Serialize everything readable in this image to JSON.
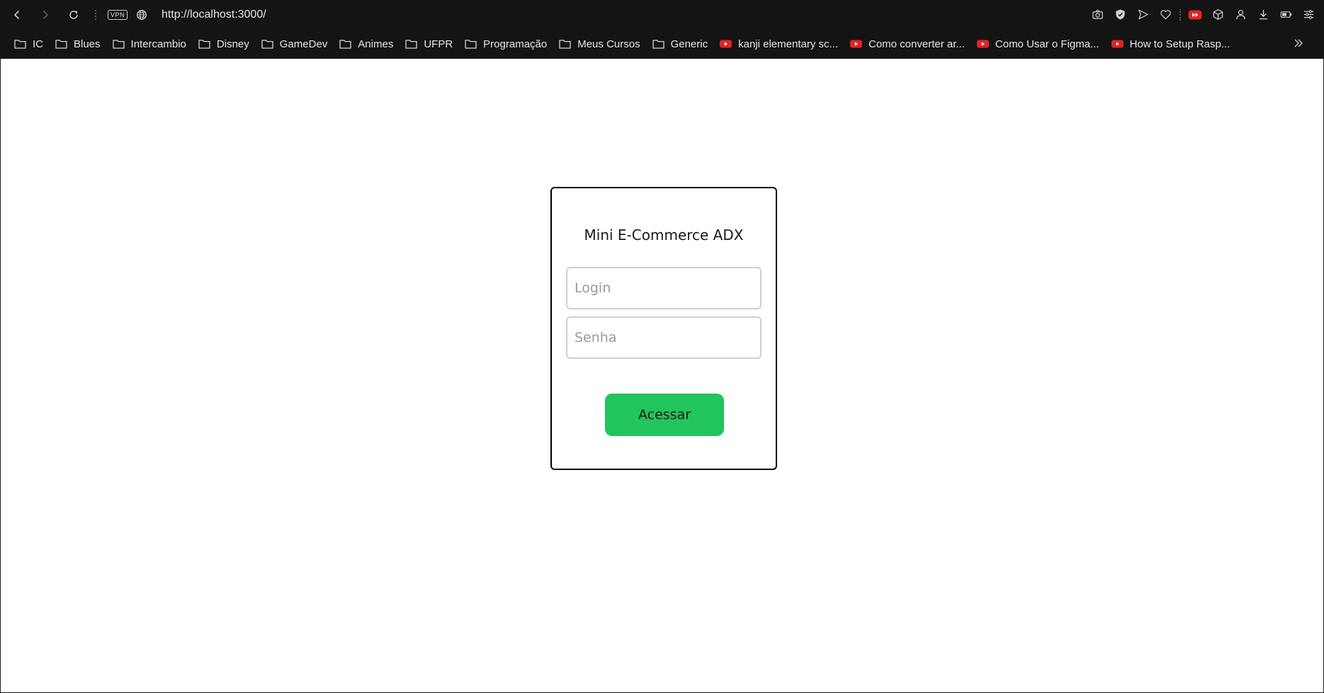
{
  "browser": {
    "vpn_label": "VPN",
    "url": "http://localhost:3000/",
    "nav": {
      "back_icon": "chevron-left-icon",
      "forward_icon": "chevron-right-icon",
      "reload_icon": "reload-icon"
    },
    "toolbar_icons": [
      "camera-icon",
      "shield-icon",
      "send-icon",
      "heart-icon",
      "youtube-icon",
      "cube-icon",
      "user-icon",
      "download-icon",
      "battery-icon",
      "menu-icon"
    ]
  },
  "bookmarks": [
    {
      "label": "IC",
      "icon": "folder-icon"
    },
    {
      "label": "Blues",
      "icon": "folder-icon"
    },
    {
      "label": "Intercambio",
      "icon": "folder-icon"
    },
    {
      "label": "Disney",
      "icon": "folder-icon"
    },
    {
      "label": "GameDev",
      "icon": "folder-icon"
    },
    {
      "label": "Animes",
      "icon": "folder-icon"
    },
    {
      "label": "UFPR",
      "icon": "folder-icon"
    },
    {
      "label": "Programação",
      "icon": "folder-icon"
    },
    {
      "label": "Meus Cursos",
      "icon": "folder-icon"
    },
    {
      "label": "Generic",
      "icon": "folder-icon"
    },
    {
      "label": "kanji elementary sc...",
      "icon": "youtube-icon"
    },
    {
      "label": "Como converter ar...",
      "icon": "youtube-icon"
    },
    {
      "label": "Como Usar o Figma...",
      "icon": "youtube-icon"
    },
    {
      "label": "How to Setup Rasp...",
      "icon": "youtube-icon"
    }
  ],
  "login": {
    "title": "Mini E-Commerce ADX",
    "login_placeholder": "Login",
    "login_value": "",
    "senha_placeholder": "Senha",
    "senha_value": "",
    "submit_label": "Acessar"
  },
  "colors": {
    "accent_button": "#22c45e",
    "youtube_red": "#e02424",
    "toolbar_bg": "#141414"
  }
}
